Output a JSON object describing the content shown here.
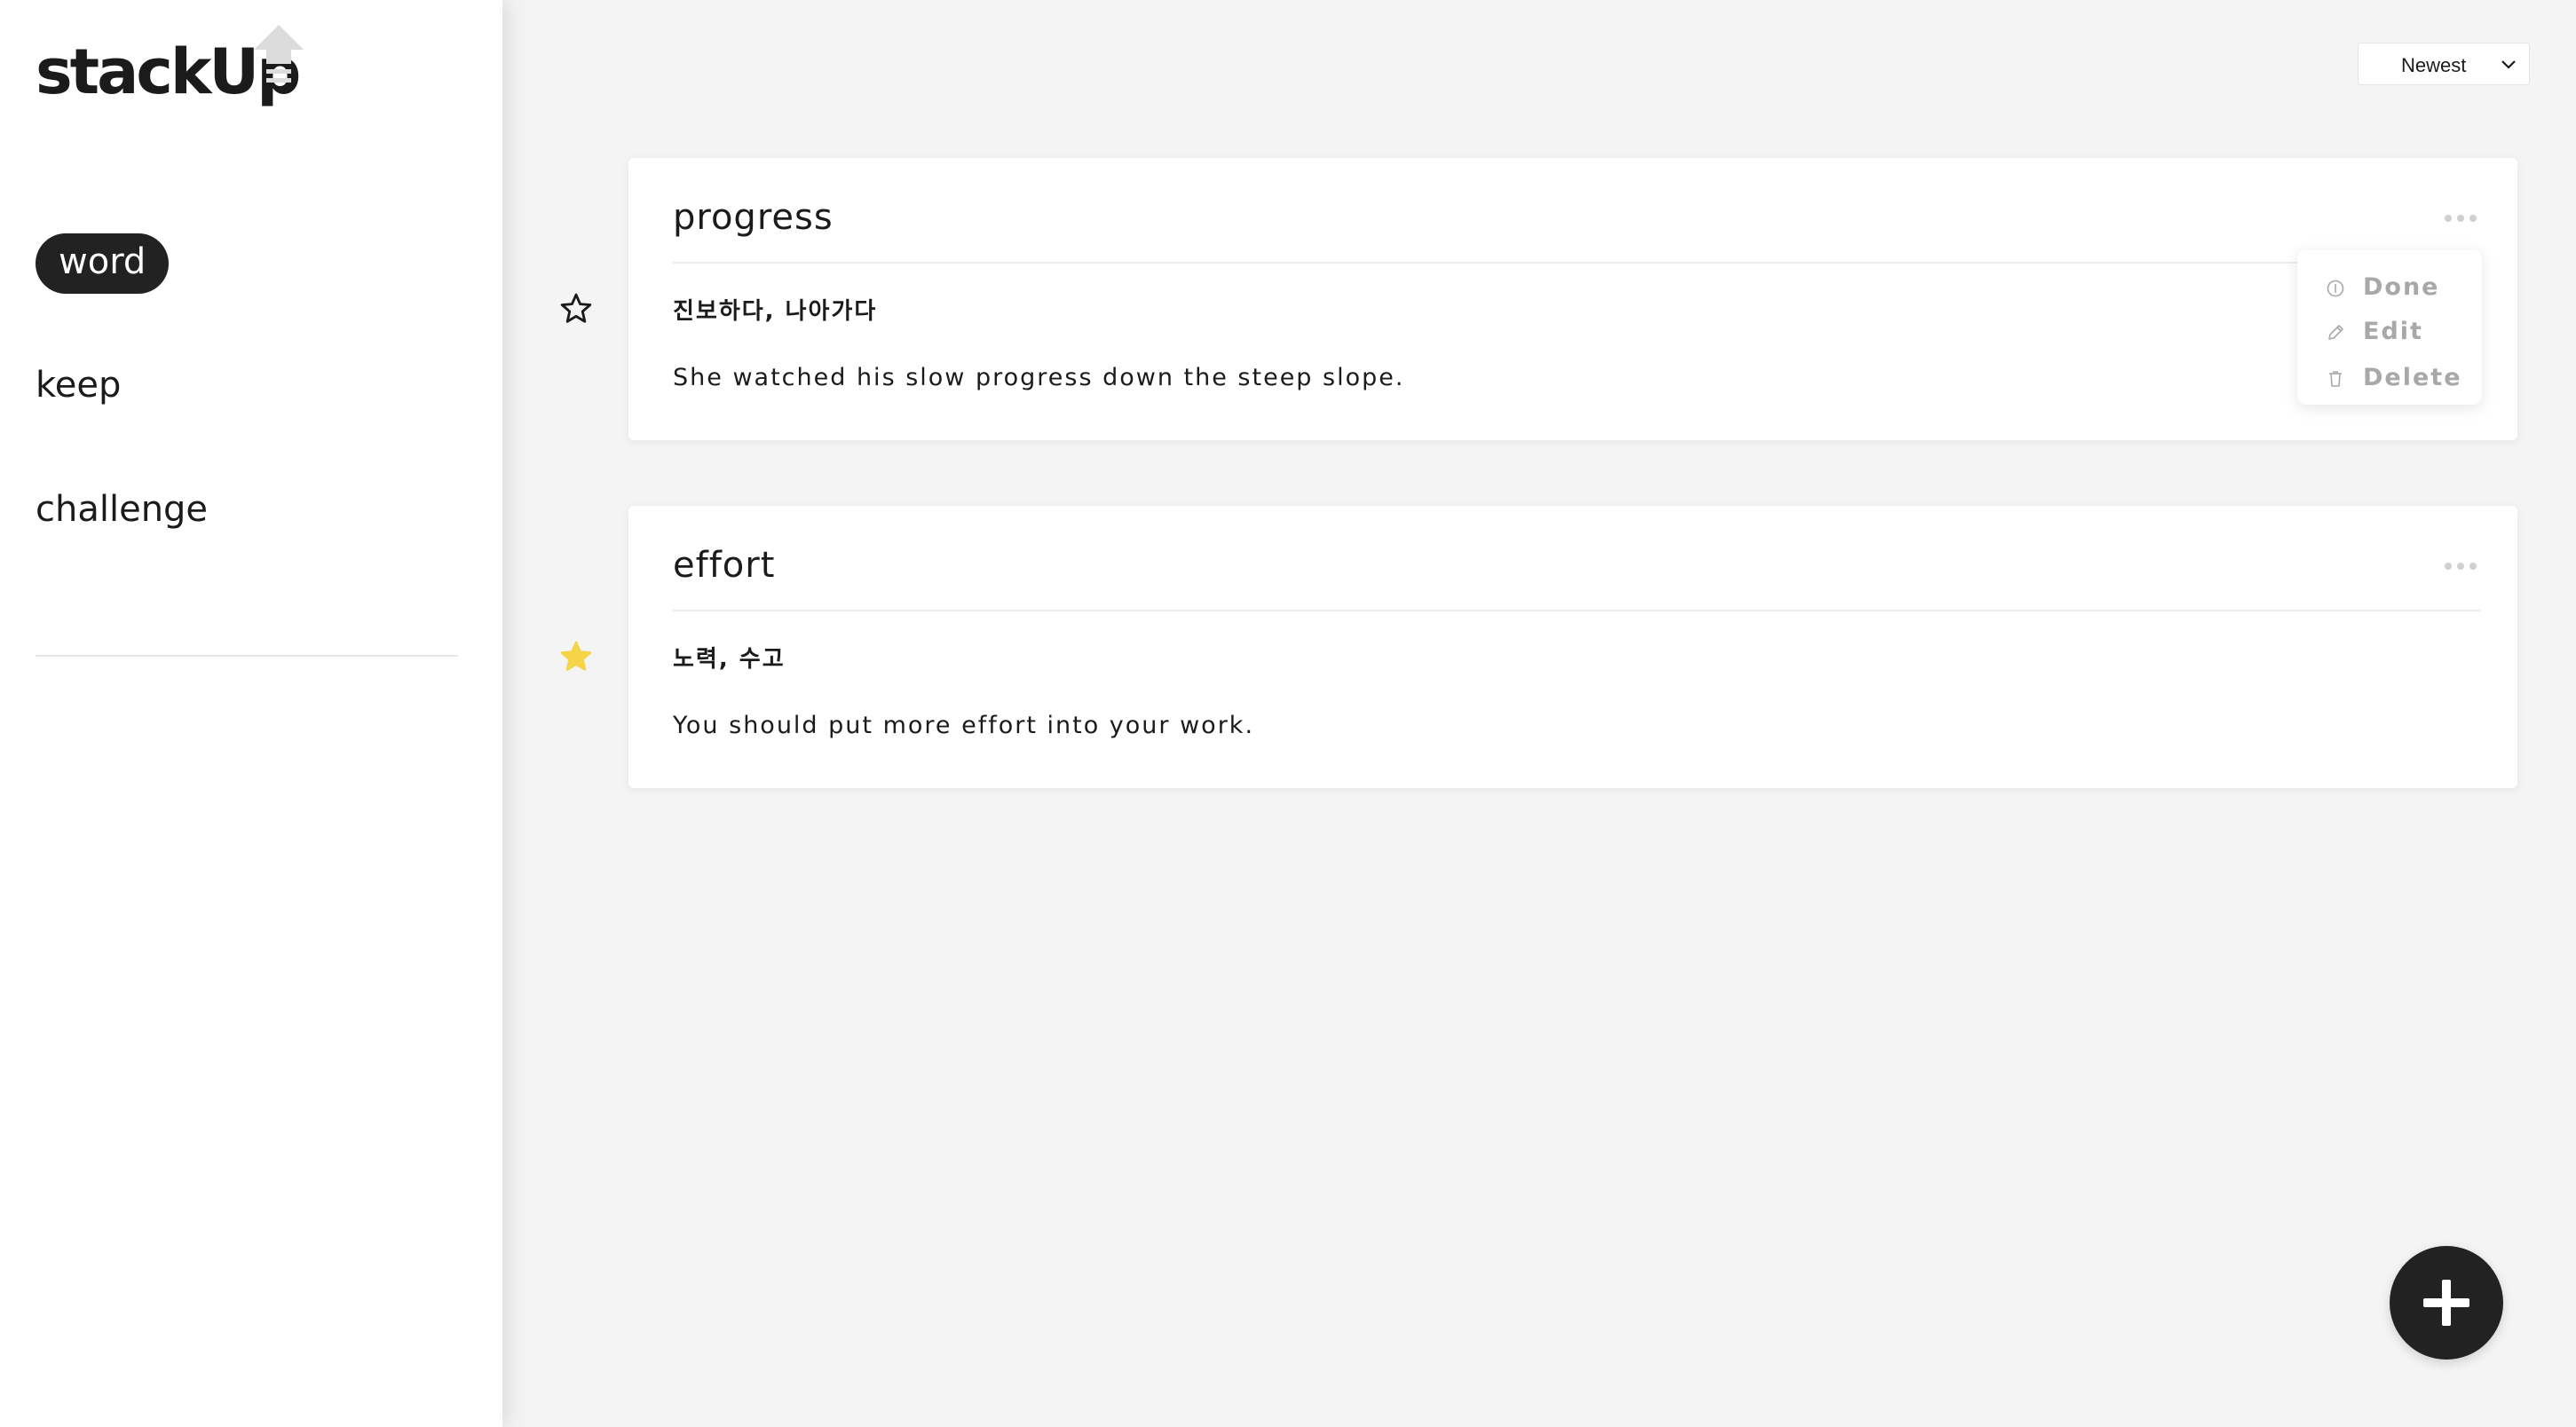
{
  "app": {
    "logo_text": "stackUp"
  },
  "sidebar": {
    "items": [
      {
        "label": "word",
        "active": true
      },
      {
        "label": "keep",
        "active": false
      },
      {
        "label": "challenge",
        "active": false
      }
    ]
  },
  "toolbar": {
    "sort_selected": "Newest"
  },
  "words": [
    {
      "word": "progress",
      "meaning": "진보하다, 나아가다",
      "example": "She watched his slow progress down the steep slope.",
      "starred": false
    },
    {
      "word": "effort",
      "meaning": "노력, 수고",
      "example": "You should put more effort into your work.",
      "starred": true
    }
  ],
  "context_menu": {
    "items": [
      {
        "label": "Done",
        "icon": "circle-icon"
      },
      {
        "label": "Edit",
        "icon": "pencil-icon"
      },
      {
        "label": "Delete",
        "icon": "trash-icon"
      }
    ]
  },
  "fab": {
    "icon": "plus-icon"
  },
  "colors": {
    "background": "#f4f4f4",
    "sidebar": "#ffffff",
    "dark": "#222222",
    "star_active": "#f5d547",
    "muted": "#a8a8a8"
  }
}
